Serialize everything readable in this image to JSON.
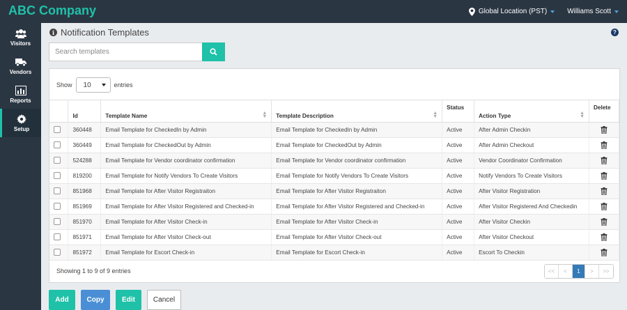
{
  "app": {
    "brand": "ABC Company",
    "location_label": "Global Location (PST)",
    "user_name": "Williams Scott",
    "accent_color": "#1fc1a8"
  },
  "sidebar": {
    "items": [
      {
        "label": "Visitors",
        "icon": "users-icon"
      },
      {
        "label": "Vendors",
        "icon": "truck-icon"
      },
      {
        "label": "Reports",
        "icon": "bar-chart-icon"
      },
      {
        "label": "Setup",
        "icon": "gear-icon",
        "active": true
      }
    ]
  },
  "page": {
    "title": "Notification Templates",
    "help": "?"
  },
  "search": {
    "placeholder": "Search templates"
  },
  "table": {
    "show_label": "Show",
    "entries_label": "entries",
    "page_size": "10",
    "columns": [
      "Id",
      "Template Name",
      "Template Description",
      "Status",
      "Action Type",
      "Delete"
    ],
    "rows": [
      {
        "id": "360448",
        "name": "Email Template for CheckedIn by Admin",
        "description": "Email Template for CheckedIn by Admin",
        "status": "Active",
        "action": "After Admin Checkin"
      },
      {
        "id": "360449",
        "name": "Email Template for CheckedOut by Admin",
        "description": "Email Template for CheckedOut by Admin",
        "status": "Active",
        "action": "After Admin Checkout"
      },
      {
        "id": "524288",
        "name": "Email Template for Vendor coordinator confirmation",
        "description": "Email Template for Vendor coordinator confirmation",
        "status": "Active",
        "action": "Vendor Coordinator Confirmation"
      },
      {
        "id": "819200",
        "name": "Email Template for Notify Vendors To Create Visitors",
        "description": "Email Template for Notify Vendors To Create Visitors",
        "status": "Active",
        "action": "Notify Vendors To Create Visitors"
      },
      {
        "id": "851968",
        "name": "Email Template for After Visitor Registraiton",
        "description": "Email Template for After Visitor Registraiton",
        "status": "Active",
        "action": "After Visitor Registration"
      },
      {
        "id": "851969",
        "name": "Email Template for After Visitor Registered and Checked-in",
        "description": "Email Template for After Visitor Registered and Checked-in",
        "status": "Active",
        "action": "After Visitor Registered And Checkedin"
      },
      {
        "id": "851970",
        "name": "Email Template for After Visitor Check-in",
        "description": "Email Template for After Visitor Check-in",
        "status": "Active",
        "action": "After Visitor Checkin"
      },
      {
        "id": "851971",
        "name": "Email Template for After Visitor Check-out",
        "description": "Email Template for After Visitor Check-out",
        "status": "Active",
        "action": "After Visitor Checkout"
      },
      {
        "id": "851972",
        "name": "Email Template for Escort Check-in",
        "description": "Email Template for Escort Check-in",
        "status": "Active",
        "action": "Escort To Checkin"
      }
    ],
    "summary": "Showing 1 to 9 of 9 entries"
  },
  "pager": {
    "first": "<<",
    "prev": "<",
    "current": "1",
    "next": ">",
    "last": ">>"
  },
  "actions": {
    "add": "Add",
    "copy": "Copy",
    "edit": "Edit",
    "cancel": "Cancel"
  }
}
